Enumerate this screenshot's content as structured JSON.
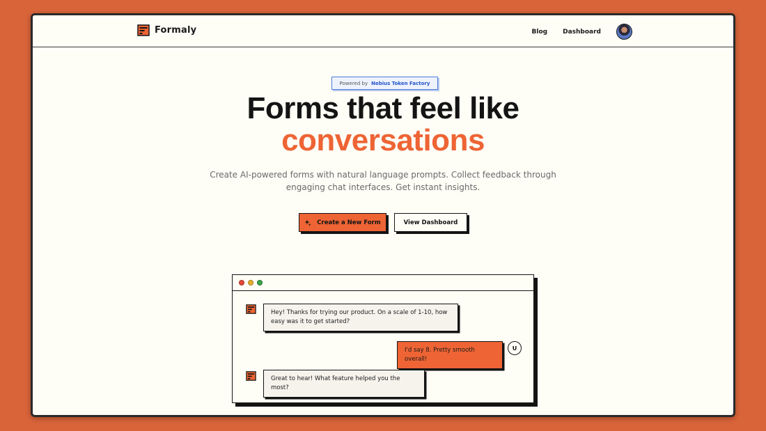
{
  "brand": {
    "name": "Formaly"
  },
  "nav": {
    "links": [
      "Blog",
      "Dashboard"
    ]
  },
  "badge": {
    "prefix": "Powered by",
    "name": "Nebius Token Factory"
  },
  "hero": {
    "title_line1": "Forms that feel like",
    "title_line2": "conversations",
    "subtitle": "Create AI-powered forms with natural language prompts. Collect feedback through engaging chat interfaces. Get instant insights."
  },
  "buttons": {
    "primary": "Create a New Form",
    "secondary": "View Dashboard"
  },
  "chat": {
    "messages": [
      {
        "role": "bot",
        "text": "Hey! Thanks for trying our product. On a scale of 1-10, how easy was it to get started?"
      },
      {
        "role": "user",
        "text": "I'd say 8. Pretty smooth overall!"
      },
      {
        "role": "bot",
        "text": "Great to hear! What feature helped you the most?"
      }
    ],
    "user_initial": "U"
  },
  "colors": {
    "accent": "#ee6434",
    "background": "#d9643a",
    "page": "#fefdf6",
    "badge_blue": "#2255cc"
  }
}
